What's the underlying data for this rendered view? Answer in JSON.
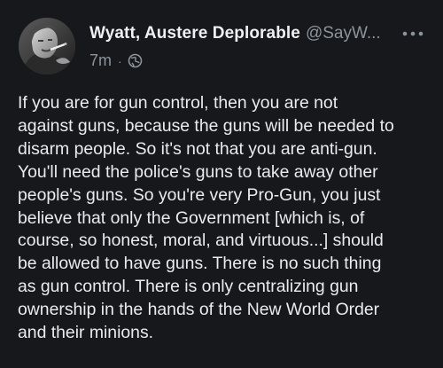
{
  "author": {
    "display_name": "Wyatt, Austere Deplorable",
    "handle": "@SayW...",
    "avatar_icon": "user-photo-avatar"
  },
  "meta": {
    "time": "7m",
    "separator": "·",
    "visibility_icon": "globe-icon"
  },
  "menu": {
    "icon": "more-options-icon"
  },
  "post": {
    "lines": [
      "If you are for gun control, then you are not",
      "against guns, because the guns will be needed to",
      "disarm people. So it's not that you are anti-gun.",
      "You'll need the police's guns to take away other",
      "people's guns. So you're very Pro-Gun, you just",
      "believe that only the Government [which is, of",
      "course, so honest, moral, and virtuous...] should",
      "be allowed to have guns. There is no such thing",
      "as gun control. There is only centralizing gun",
      "ownership in the hands of the New World Order",
      "and their minions."
    ]
  },
  "colors": {
    "background": "#17181c",
    "text_primary": "#e9ebec",
    "text_secondary": "#8b949a"
  }
}
